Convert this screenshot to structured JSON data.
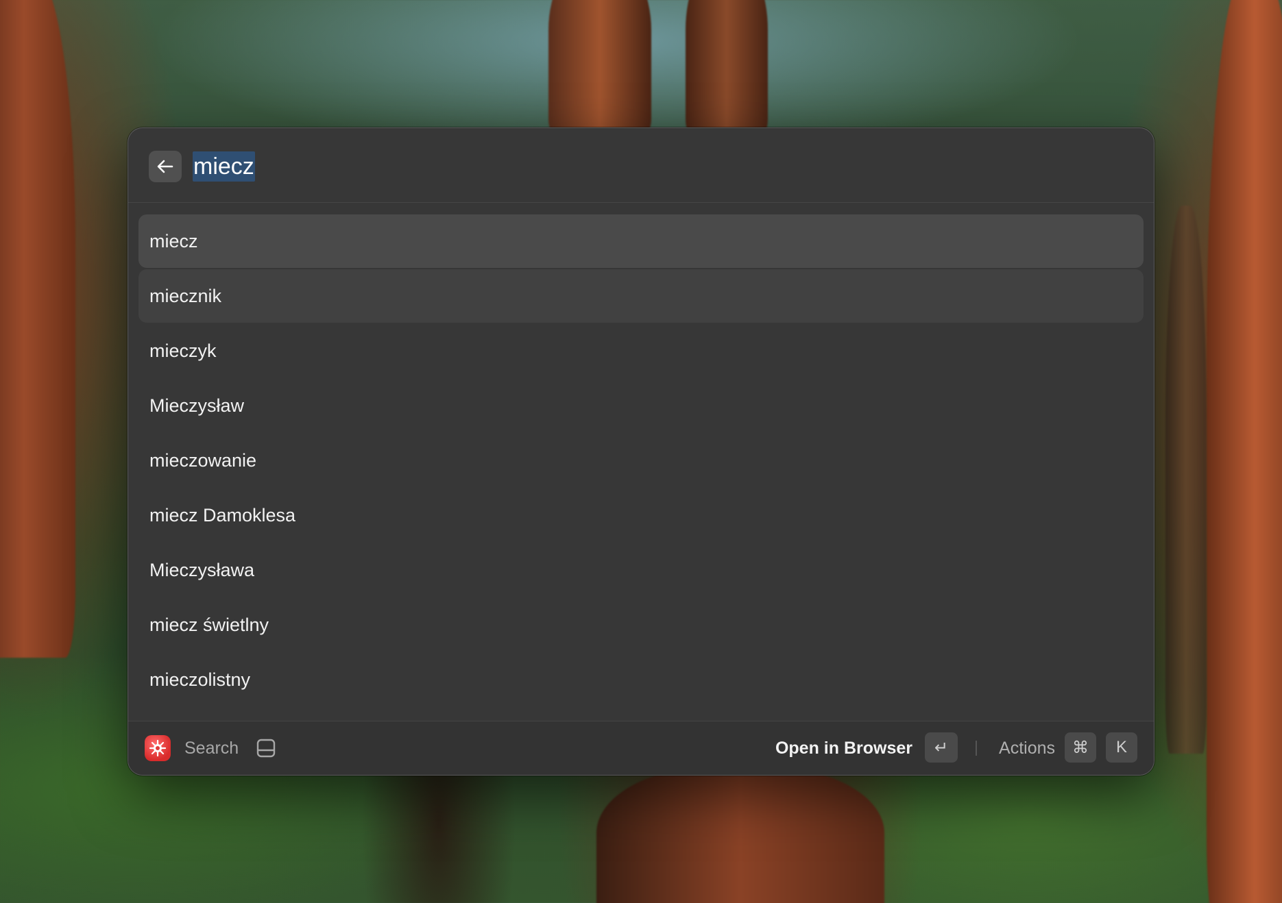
{
  "search": {
    "query": "miecz"
  },
  "results": [
    {
      "label": "miecz"
    },
    {
      "label": "miecznik"
    },
    {
      "label": "mieczyk"
    },
    {
      "label": "Mieczysław"
    },
    {
      "label": "mieczowanie"
    },
    {
      "label": "miecz Damoklesa"
    },
    {
      "label": "Mieczysława"
    },
    {
      "label": "miecz świetlny"
    },
    {
      "label": "mieczolistny"
    }
  ],
  "footer": {
    "extension_title": "Search",
    "primary_action": "Open in Browser",
    "enter_key": "↵",
    "actions_label": "Actions",
    "cmd_key": "⌘",
    "k_key": "K"
  },
  "icons": {
    "back": "back-arrow-icon",
    "extension": "extension-icon",
    "panel": "detail-panel-icon"
  },
  "colors": {
    "window_bg": "#373737",
    "selected_row": "#4a4a4a",
    "hovered_row": "#414141",
    "text_selection": "#2f4f73",
    "extension_accent": "#e03a3a"
  }
}
